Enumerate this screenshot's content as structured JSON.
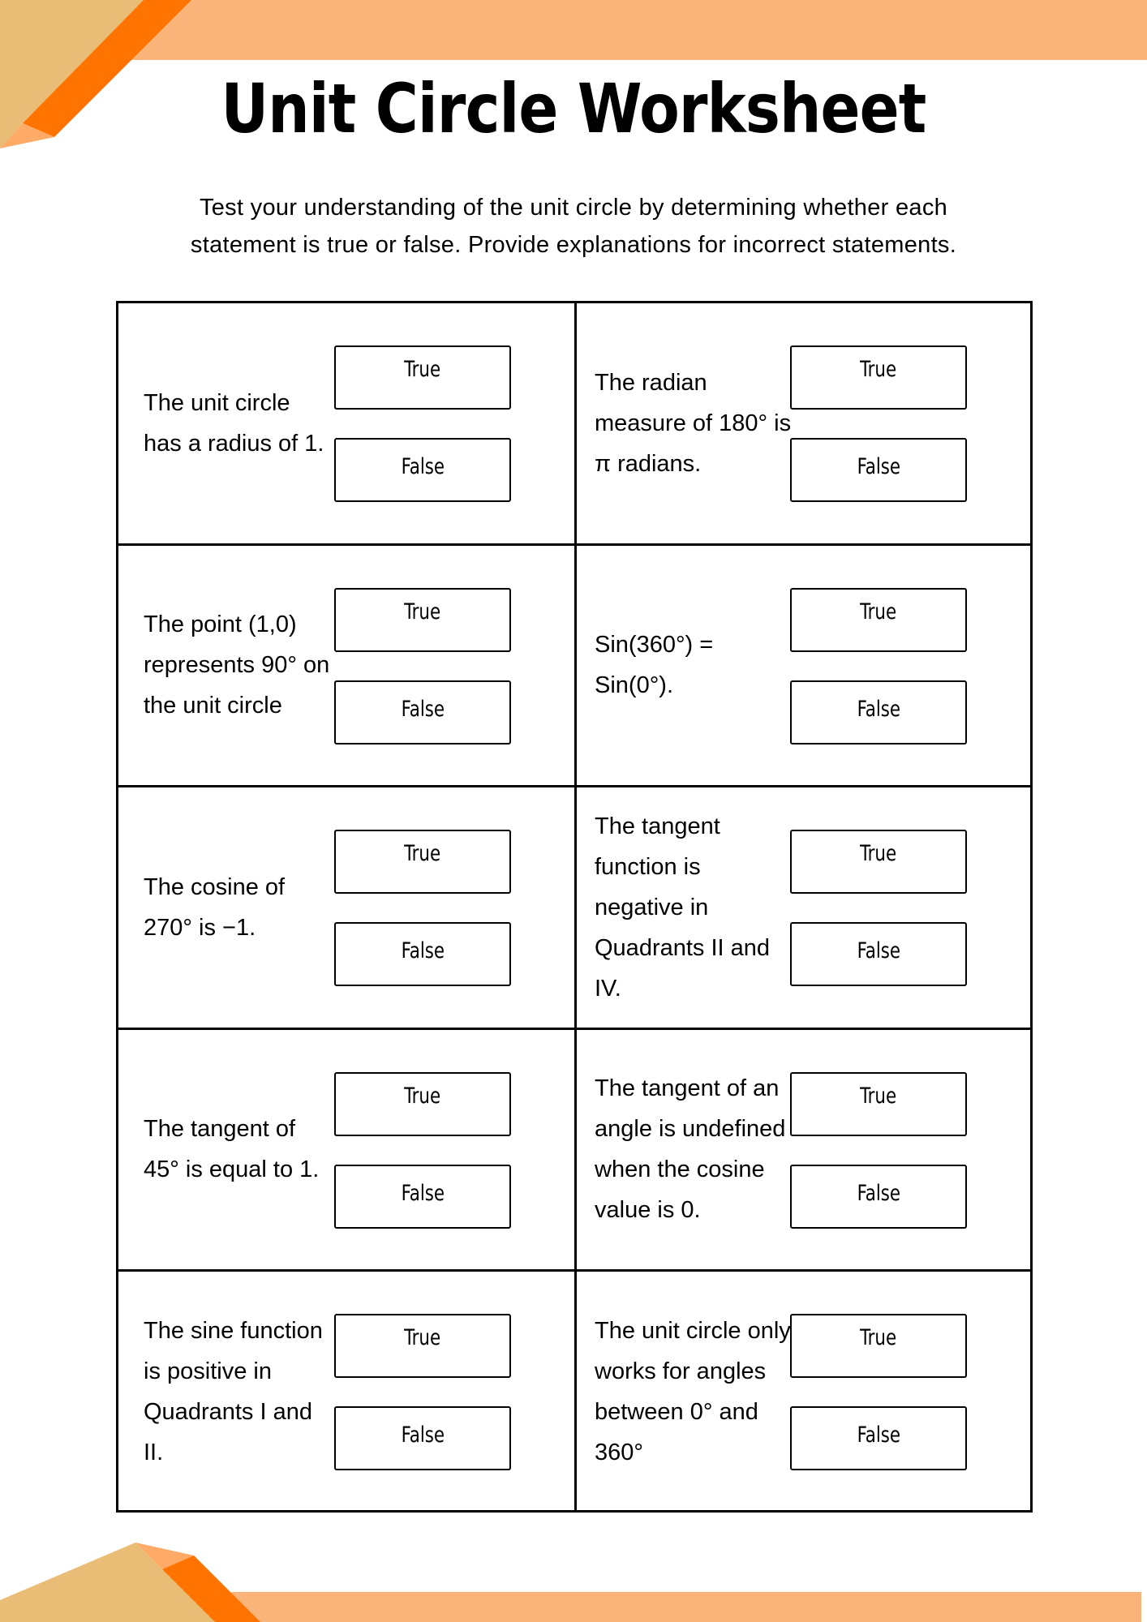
{
  "title": "Unit Circle Worksheet",
  "instructions": {
    "line1": "Test your understanding of the unit circle by determining whether each",
    "line2": "statement is true or false. Provide explanations for incorrect statements."
  },
  "colors": {
    "top_bar": "#FAB378",
    "tan": "#EABD77",
    "orange": "#FF7400",
    "peach": "#FFAA66",
    "border": "#000000"
  },
  "option_labels": {
    "true": "True",
    "false": "False"
  },
  "questions": [
    {
      "statement": "The unit circle has a radius of 1."
    },
    {
      "statement": "The radian measure of 180° is π radians."
    },
    {
      "statement": "The point (1,0) represents 90° on the unit circle"
    },
    {
      "statement": "Sin(360°) = Sin(0°)."
    },
    {
      "statement": "The cosine of 270° is −1."
    },
    {
      "statement": "The tangent function is negative in Quadrants II and IV."
    },
    {
      "statement": "The tangent of 45° is equal to 1."
    },
    {
      "statement": "The tangent of an angle is undefined when the cosine value is 0."
    },
    {
      "statement": "The sine function is positive in Quadrants I and II."
    },
    {
      "statement": "The unit circle only works for angles between 0° and 360°"
    }
  ]
}
